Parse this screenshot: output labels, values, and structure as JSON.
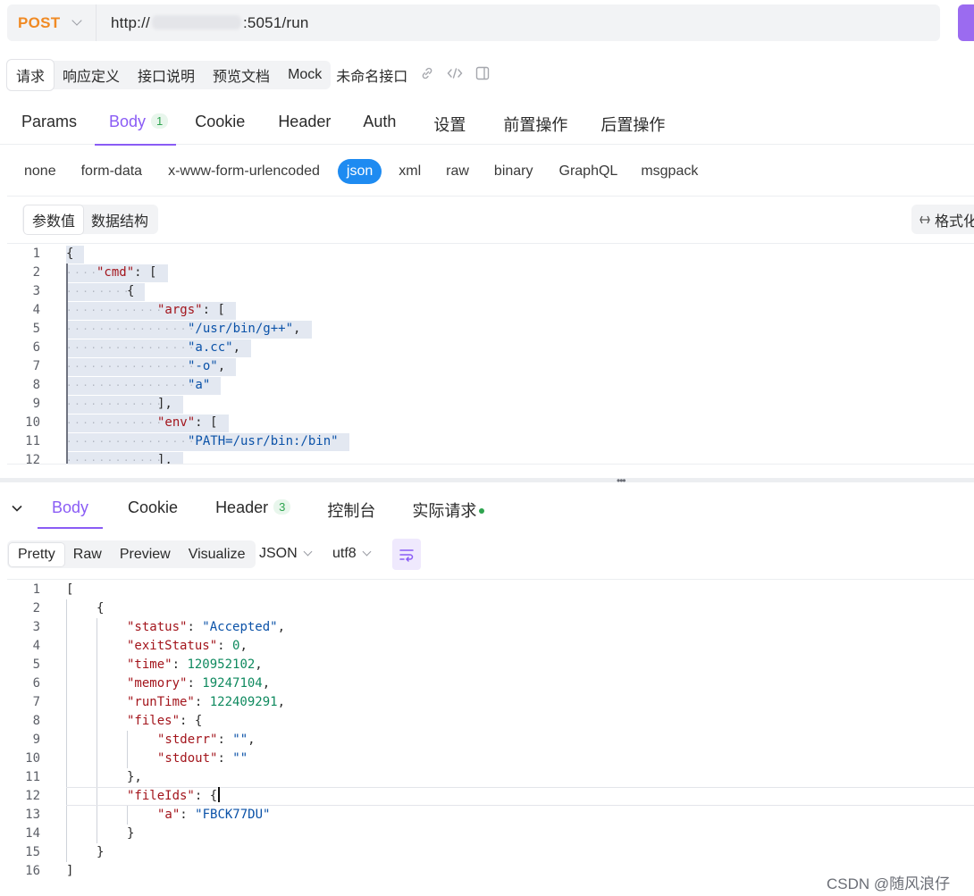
{
  "request": {
    "method": "POST",
    "url_prefix": "http://",
    "url_suffix": ":5051/run"
  },
  "doc_tabs": [
    {
      "label": "请求",
      "active": true
    },
    {
      "label": "响应定义",
      "active": false
    },
    {
      "label": "接口说明",
      "active": false
    },
    {
      "label": "预览文档",
      "active": false
    },
    {
      "label": "Mock",
      "active": false
    }
  ],
  "doc_name": "未命名接口",
  "request_tabs": [
    {
      "label": "Params"
    },
    {
      "label": "Body",
      "badge": "1",
      "active": true
    },
    {
      "label": "Cookie"
    },
    {
      "label": "Header"
    },
    {
      "label": "Auth"
    },
    {
      "label": "设置"
    },
    {
      "label": "前置操作"
    },
    {
      "label": "后置操作"
    }
  ],
  "body_types": [
    "none",
    "form-data",
    "x-www-form-urlencoded",
    "json",
    "xml",
    "raw",
    "binary",
    "GraphQL",
    "msgpack"
  ],
  "body_type_active": "json",
  "body_view": {
    "param_value": "参数值",
    "data_structure": "数据结构",
    "format_label": "格式化"
  },
  "request_body_lines": [
    {
      "n": "1",
      "indent": 0,
      "tokens": [
        [
          "p",
          "{"
        ]
      ]
    },
    {
      "n": "2",
      "indent": 1,
      "tokens": [
        [
          "k",
          "\"cmd\""
        ],
        [
          "p",
          ": ["
        ]
      ]
    },
    {
      "n": "3",
      "indent": 2,
      "tokens": [
        [
          "p",
          "{"
        ]
      ]
    },
    {
      "n": "4",
      "indent": 3,
      "tokens": [
        [
          "k",
          "\"args\""
        ],
        [
          "p",
          ": ["
        ]
      ]
    },
    {
      "n": "5",
      "indent": 4,
      "tokens": [
        [
          "s",
          "\"/usr/bin/g++\""
        ],
        [
          "p",
          ","
        ]
      ]
    },
    {
      "n": "6",
      "indent": 4,
      "tokens": [
        [
          "s",
          "\"a.cc\""
        ],
        [
          "p",
          ","
        ]
      ]
    },
    {
      "n": "7",
      "indent": 4,
      "tokens": [
        [
          "s",
          "\"-o\""
        ],
        [
          "p",
          ","
        ]
      ]
    },
    {
      "n": "8",
      "indent": 4,
      "tokens": [
        [
          "s",
          "\"a\""
        ]
      ]
    },
    {
      "n": "9",
      "indent": 3,
      "tokens": [
        [
          "p",
          "],"
        ]
      ]
    },
    {
      "n": "10",
      "indent": 3,
      "tokens": [
        [
          "k",
          "\"env\""
        ],
        [
          "p",
          ": ["
        ]
      ]
    },
    {
      "n": "11",
      "indent": 4,
      "tokens": [
        [
          "s",
          "\"PATH=/usr/bin:/bin\""
        ]
      ]
    },
    {
      "n": "12",
      "indent": 3,
      "tokens": [
        [
          "p",
          "],"
        ]
      ]
    }
  ],
  "response_tabs": [
    {
      "label": "Body",
      "active": true
    },
    {
      "label": "Cookie"
    },
    {
      "label": "Header",
      "badge": "3"
    },
    {
      "label": "控制台"
    },
    {
      "label": "实际请求",
      "dot": true
    }
  ],
  "response_views": [
    "Pretty",
    "Raw",
    "Preview",
    "Visualize"
  ],
  "response_view_active": "Pretty",
  "response_format": "JSON",
  "response_encoding": "utf8",
  "response_body_lines": [
    {
      "n": "1",
      "indent": 0,
      "tokens": [
        [
          "p",
          "["
        ]
      ]
    },
    {
      "n": "2",
      "indent": 1,
      "tokens": [
        [
          "p",
          "{"
        ]
      ]
    },
    {
      "n": "3",
      "indent": 2,
      "tokens": [
        [
          "k",
          "\"status\""
        ],
        [
          "p",
          ": "
        ],
        [
          "s",
          "\"Accepted\""
        ],
        [
          "p",
          ","
        ]
      ]
    },
    {
      "n": "4",
      "indent": 2,
      "tokens": [
        [
          "k",
          "\"exitStatus\""
        ],
        [
          "p",
          ": "
        ],
        [
          "n",
          "0"
        ],
        [
          "p",
          ","
        ]
      ]
    },
    {
      "n": "5",
      "indent": 2,
      "tokens": [
        [
          "k",
          "\"time\""
        ],
        [
          "p",
          ": "
        ],
        [
          "n",
          "120952102"
        ],
        [
          "p",
          ","
        ]
      ]
    },
    {
      "n": "6",
      "indent": 2,
      "tokens": [
        [
          "k",
          "\"memory\""
        ],
        [
          "p",
          ": "
        ],
        [
          "n",
          "19247104"
        ],
        [
          "p",
          ","
        ]
      ]
    },
    {
      "n": "7",
      "indent": 2,
      "tokens": [
        [
          "k",
          "\"runTime\""
        ],
        [
          "p",
          ": "
        ],
        [
          "n",
          "122409291"
        ],
        [
          "p",
          ","
        ]
      ]
    },
    {
      "n": "8",
      "indent": 2,
      "tokens": [
        [
          "k",
          "\"files\""
        ],
        [
          "p",
          ": {"
        ]
      ]
    },
    {
      "n": "9",
      "indent": 3,
      "tokens": [
        [
          "k",
          "\"stderr\""
        ],
        [
          "p",
          ": "
        ],
        [
          "s",
          "\"\""
        ],
        [
          "p",
          ","
        ]
      ]
    },
    {
      "n": "10",
      "indent": 3,
      "tokens": [
        [
          "k",
          "\"stdout\""
        ],
        [
          "p",
          ": "
        ],
        [
          "s",
          "\"\""
        ]
      ]
    },
    {
      "n": "11",
      "indent": 2,
      "tokens": [
        [
          "p",
          "},"
        ]
      ]
    },
    {
      "n": "12",
      "indent": 2,
      "tokens": [
        [
          "k",
          "\"fileIds\""
        ],
        [
          "p",
          ": {"
        ]
      ],
      "cursor": true
    },
    {
      "n": "13",
      "indent": 3,
      "tokens": [
        [
          "k",
          "\"a\""
        ],
        [
          "p",
          ": "
        ],
        [
          "s",
          "\"FBCK77DU\""
        ]
      ]
    },
    {
      "n": "14",
      "indent": 2,
      "tokens": [
        [
          "p",
          "}"
        ]
      ]
    },
    {
      "n": "15",
      "indent": 1,
      "tokens": [
        [
          "p",
          "}"
        ]
      ]
    },
    {
      "n": "16",
      "indent": 0,
      "tokens": [
        [
          "p",
          "]"
        ]
      ]
    }
  ],
  "watermark": "CSDN @随风浪仔",
  "colors": {
    "accent": "#8a5cf5",
    "method": "#f08a24",
    "json_active": "#1e8bf1",
    "badge_green": "#2ea44f"
  }
}
